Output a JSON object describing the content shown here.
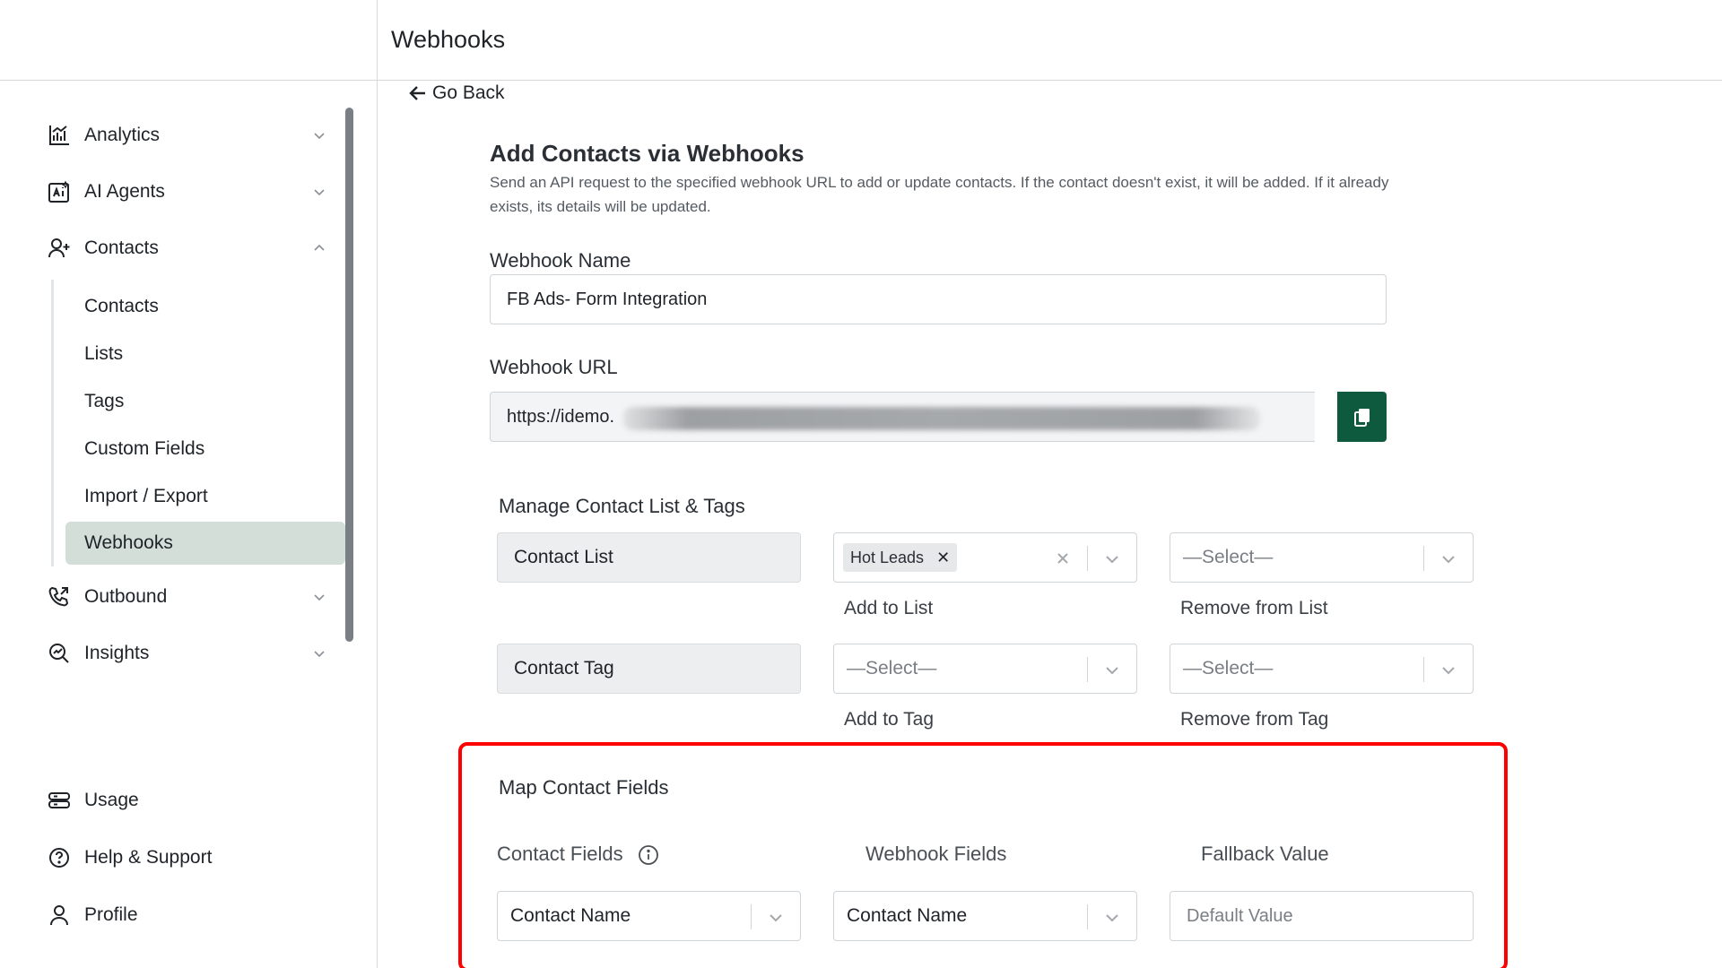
{
  "header": {
    "title": "Webhooks"
  },
  "sidebar": {
    "items": [
      {
        "label": "Analytics",
        "icon": "analytics-icon",
        "expanded": false
      },
      {
        "label": "AI Agents",
        "icon": "ai-agents-icon",
        "expanded": false
      },
      {
        "label": "Contacts",
        "icon": "contacts-icon",
        "expanded": true
      },
      {
        "label": "Outbound",
        "icon": "outbound-call-icon",
        "expanded": false
      },
      {
        "label": "Insights",
        "icon": "insights-icon",
        "expanded": false
      }
    ],
    "sub_items": [
      "Contacts",
      "Lists",
      "Tags",
      "Custom Fields",
      "Import / Export",
      "Webhooks"
    ],
    "active_sub_item": "Webhooks",
    "bottom_items": [
      {
        "label": "Usage",
        "icon": "usage-icon"
      },
      {
        "label": "Help & Support",
        "icon": "help-icon"
      },
      {
        "label": "Profile",
        "icon": "profile-icon"
      }
    ]
  },
  "main": {
    "go_back": "Go Back",
    "form_title": "Add Contacts via Webhooks",
    "form_description": "Send an API request to the specified webhook URL to add or update contacts. If the contact doesn't exist, it will be added. If it already exists, its details will be updated.",
    "webhook_name_label": "Webhook Name",
    "webhook_name_value": "FB Ads- Form Integration",
    "webhook_url_label": "Webhook URL",
    "webhook_url_value": "https://idemo.",
    "manage_title": "Manage Contact List & Tags",
    "contact_list_label": "Contact List",
    "contact_tag_label": "Contact Tag",
    "add_to_list_chip": "Hot Leads",
    "select_placeholder": "—Select—",
    "add_to_list_caption": "Add to List",
    "remove_from_list_caption": "Remove from List",
    "add_to_tag_caption": "Add to Tag",
    "remove_from_tag_caption": "Remove from Tag",
    "map_title": "Map Contact Fields",
    "col_contact_fields": "Contact Fields",
    "col_webhook_fields": "Webhook Fields",
    "col_fallback_value": "Fallback Value",
    "contact_field_value": "Contact Name",
    "webhook_field_value": "Contact Name",
    "fallback_placeholder": "Default Value"
  },
  "colors": {
    "brand_green": "#0d5a3e",
    "highlight_red": "#ff0000",
    "active_nav_bg": "#d3ded8"
  }
}
